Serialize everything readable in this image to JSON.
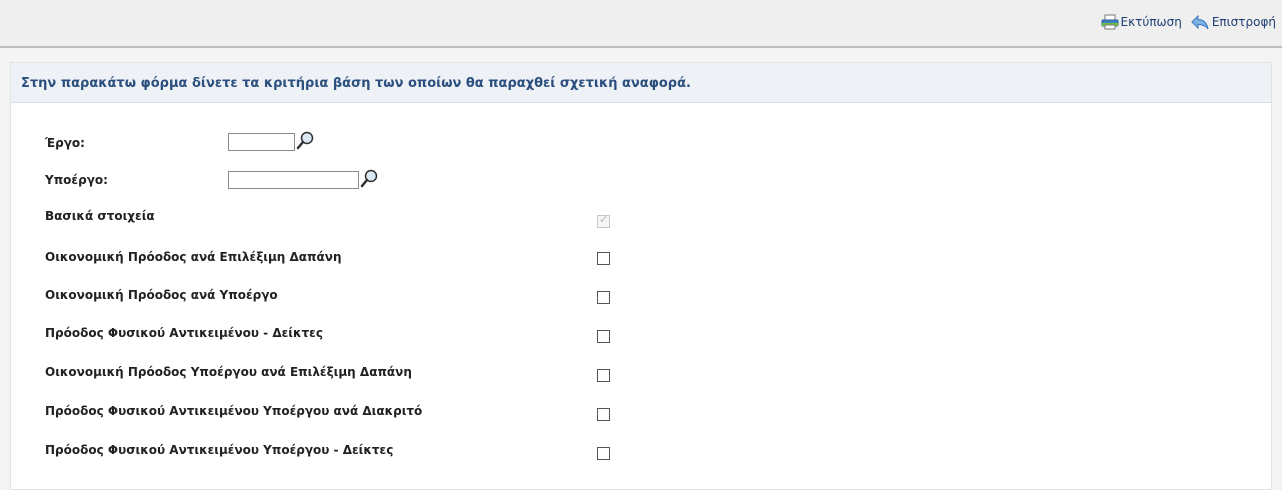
{
  "toolbar": {
    "print_label": "Εκτύπωση",
    "back_label": "Επιστροφή"
  },
  "intro": {
    "text": "Στην παρακάτω φόρμα δίνετε τα κριτήρια βάση των οποίων θα παραχθεί σχετική αναφορά."
  },
  "form": {
    "project": {
      "label": "Έργο:",
      "value": ""
    },
    "subproject": {
      "label": "Υποέργο:",
      "value": ""
    },
    "options": [
      {
        "label": "Βασικά στοιχεία",
        "checked": true,
        "disabled": true
      },
      {
        "label": "Οικονομική Πρόοδος ανά Επιλέξιμη Δαπάνη",
        "checked": false
      },
      {
        "label": "Οικονομική Πρόοδος ανά Υποέργο",
        "checked": false
      },
      {
        "label": "Πρόοδος Φυσικού Αντικειμένου - Δείκτες",
        "checked": false
      },
      {
        "label": "Οικονομική Πρόοδος Υποέργου ανά Επιλέξιμη Δαπάνη",
        "checked": false
      },
      {
        "label": "Πρόοδος Φυσικού Αντικειμένου Υποέργου ανά Διακριτό",
        "checked": false
      },
      {
        "label": "Πρόοδος Φυσικού Αντικειμένου Υποέργου - Δείκτες",
        "checked": false
      }
    ]
  },
  "icons": {
    "print": "printer-icon",
    "back": "back-arrow-icon",
    "search": "magnifier-icon"
  }
}
